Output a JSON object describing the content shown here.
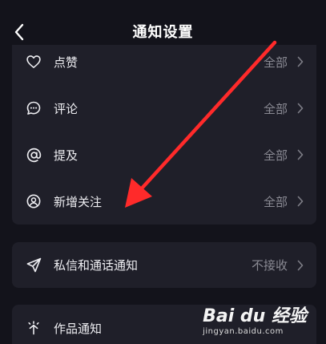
{
  "header": {
    "title": "通知设置"
  },
  "card1": {
    "items": [
      {
        "label": "点赞",
        "value": "全部",
        "icon": "heart-icon"
      },
      {
        "label": "评论",
        "value": "全部",
        "icon": "comment-icon"
      },
      {
        "label": "提及",
        "value": "全部",
        "icon": "at-icon"
      },
      {
        "label": "新增关注",
        "value": "全部",
        "icon": "user-add-icon"
      }
    ]
  },
  "card2": {
    "items": [
      {
        "label": "私信和通话通知",
        "value": "不接收",
        "icon": "send-icon"
      }
    ]
  },
  "card3": {
    "items": [
      {
        "label": "作品通知",
        "value": "",
        "icon": "sparkle-icon"
      }
    ]
  },
  "watermark": {
    "logo": "Bai du 经验",
    "url": "jingyan.baidu.com"
  },
  "colors": {
    "background": "#13131b",
    "card": "#1f1f29",
    "accent_arrow": "#ff2a2a",
    "muted_text": "#8a8a93"
  }
}
